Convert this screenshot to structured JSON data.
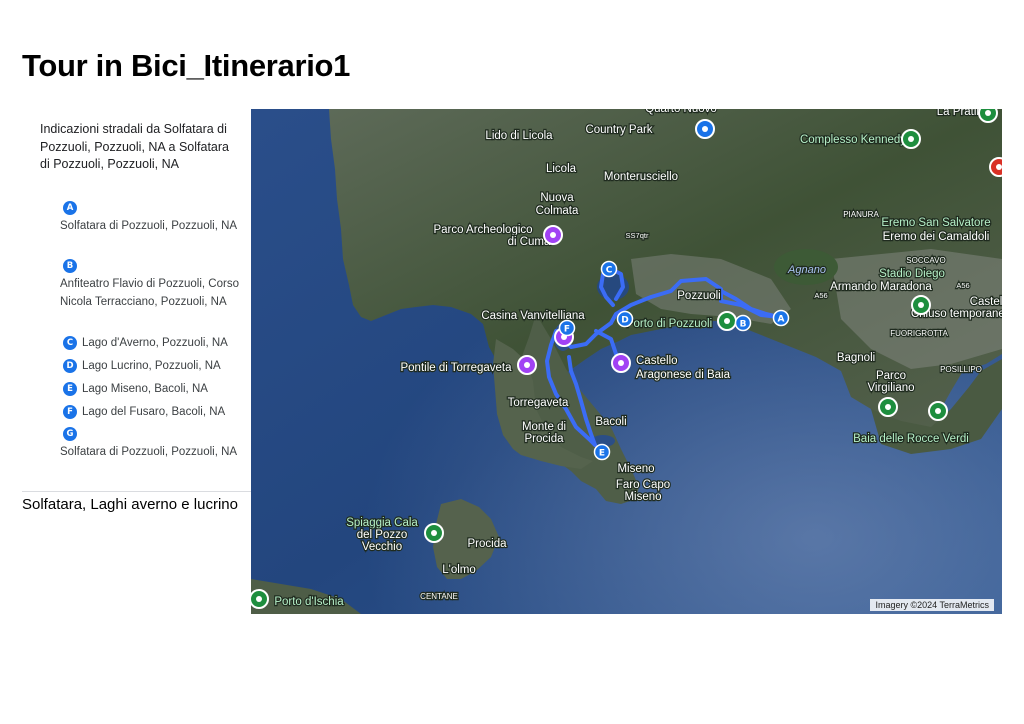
{
  "document": {
    "title": "Tour in Bici_Itinerario1",
    "subtitle": "Solfatara, Laghi averno e lucrino"
  },
  "directions": {
    "heading": "Indicazioni stradali da Solfatara di Pozzuoli, Pozzuoli, NA a Solfatara di Pozzuoli, Pozzuoli, NA",
    "stops": [
      {
        "marker": "A",
        "name": "Solfatara di Pozzuoli, Pozzuoli, NA"
      },
      {
        "marker": "B",
        "name": "Anfiteatro Flavio di Pozzuoli, Corso Nicola Terracciano, Pozzuoli, NA"
      },
      {
        "marker": "C",
        "name": "Lago d'Averno, Pozzuoli, NA"
      },
      {
        "marker": "D",
        "name": "Lago Lucrino, Pozzuoli, NA"
      },
      {
        "marker": "E",
        "name": "Lago Miseno, Bacoli, NA"
      },
      {
        "marker": "F",
        "name": "Lago del Fusaro, Bacoli, NA"
      },
      {
        "marker": "G",
        "name": "Solfatara di Pozzuoli, Pozzuoli, NA"
      }
    ]
  },
  "map": {
    "attribution": "Imagery ©2024 TerraMetrics",
    "route_color": "#3b6cf5",
    "marker_color": "#1a73e8",
    "labels": [
      {
        "text": "Quarto Nuovo",
        "kind": "place"
      },
      {
        "text": "La Pratina",
        "kind": "place"
      },
      {
        "text": "Lido di Licola",
        "kind": "place"
      },
      {
        "text": "Country Park",
        "kind": "place"
      },
      {
        "text": "Complesso Kennedy",
        "kind": "poi"
      },
      {
        "text": "Licola",
        "kind": "place"
      },
      {
        "text": "Monterusciello",
        "kind": "place"
      },
      {
        "text": "Nuova",
        "kind": "place"
      },
      {
        "text": "Colmata",
        "kind": "place"
      },
      {
        "text": "PIANURA",
        "kind": "district"
      },
      {
        "text": "Eremo San Salvatore",
        "kind": "poi"
      },
      {
        "text": "Eremo dei Camaldoli",
        "kind": "poi"
      },
      {
        "text": "Parco Archeologico",
        "kind": "poi"
      },
      {
        "text": "di Cuma",
        "kind": "poi"
      },
      {
        "text": "SS7qtr",
        "kind": "road"
      },
      {
        "text": "SOCCAVO",
        "kind": "district"
      },
      {
        "text": "Agnano",
        "kind": "water"
      },
      {
        "text": "Stadio Diego",
        "kind": "poi"
      },
      {
        "text": "Armando Maradona",
        "kind": "poi"
      },
      {
        "text": "Pozzuoli",
        "kind": "place"
      },
      {
        "text": "A56",
        "kind": "road"
      },
      {
        "text": "A56",
        "kind": "road"
      },
      {
        "text": "Castel",
        "kind": "place"
      },
      {
        "text": "Chiuso temporaneamente",
        "kind": "poi"
      },
      {
        "text": "Casina Vanvitelliana",
        "kind": "poi"
      },
      {
        "text": "Porto di Pozzuoli",
        "kind": "poi"
      },
      {
        "text": "FUORIGROTTA",
        "kind": "district"
      },
      {
        "text": "Castello",
        "kind": "poi"
      },
      {
        "text": "Aragonese di Baia",
        "kind": "poi"
      },
      {
        "text": "Bagnoli",
        "kind": "place"
      },
      {
        "text": "Pontile di Torregaveta",
        "kind": "poi"
      },
      {
        "text": "POSILLIPO",
        "kind": "district"
      },
      {
        "text": "Parco",
        "kind": "poi"
      },
      {
        "text": "Virgiliano",
        "kind": "poi"
      },
      {
        "text": "Torregaveta",
        "kind": "place"
      },
      {
        "text": "Bacoli",
        "kind": "place"
      },
      {
        "text": "Monte di",
        "kind": "place"
      },
      {
        "text": "Procida",
        "kind": "place"
      },
      {
        "text": "Baia delle Rocce Verdi",
        "kind": "poi"
      },
      {
        "text": "Miseno",
        "kind": "place"
      },
      {
        "text": "Faro Capo",
        "kind": "place"
      },
      {
        "text": "Miseno",
        "kind": "place"
      },
      {
        "text": "Spiaggia Cala",
        "kind": "poi"
      },
      {
        "text": "del Pozzo",
        "kind": "poi"
      },
      {
        "text": "Vecchio",
        "kind": "poi"
      },
      {
        "text": "Procida",
        "kind": "place"
      },
      {
        "text": "L'olmo",
        "kind": "place"
      },
      {
        "text": "CENTANE",
        "kind": "district"
      },
      {
        "text": "Porto d'Ischia",
        "kind": "poi"
      }
    ],
    "route_markers": [
      "A",
      "B",
      "C",
      "D",
      "E",
      "F"
    ]
  }
}
